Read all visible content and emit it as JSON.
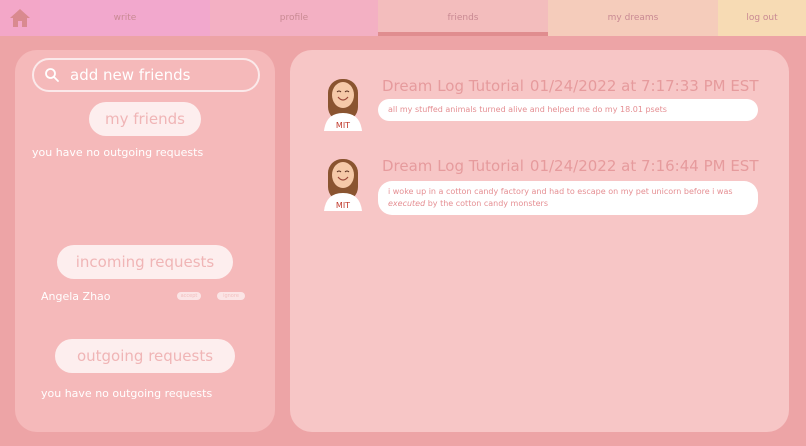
{
  "nav": {
    "home_icon": "home-icon",
    "tabs": [
      {
        "label": "write"
      },
      {
        "label": "profile"
      },
      {
        "label": "friends"
      },
      {
        "label": "my dreams"
      },
      {
        "label": "log out"
      }
    ],
    "active_tab": "friends",
    "colors": {
      "write": "#f2a8cd",
      "profile": "#f3b0c3",
      "friends": "#f3bdbd",
      "my_dreams": "#f5ccbb",
      "log_out": "#f7dbb4"
    }
  },
  "friends_panel": {
    "search": {
      "placeholder": "add new friends",
      "icon": "search-icon"
    },
    "my_friends_label": "my friends",
    "my_friends_text": "you have no outgoing requests",
    "incoming_label": "incoming requests",
    "incoming_requests": [
      {
        "name": "Angela Zhao",
        "accept_label": "accept",
        "reject_label": "ignore"
      }
    ],
    "outgoing_label": "outgoing requests",
    "outgoing_text": "you have no outgoing requests"
  },
  "feed": {
    "entries": [
      {
        "author": "Dream Log Tutorial",
        "timestamp": "01/24/2022 at 7:17:33 PM EST",
        "text": "all my stuffed animals turned alive and helped me do my 18.01 psets"
      },
      {
        "author": "Dream Log Tutorial",
        "timestamp": "01/24/2022 at 7:16:44 PM EST",
        "text_before": "i woke up in a cotton candy factory and had to escape on my pet unicorn before i was ",
        "text_emphasis": "executed",
        "text_after": " by the cotton candy monsters"
      }
    ],
    "avatar_label": "MIT"
  },
  "colors": {
    "background": "#eda4a6",
    "left_panel": "#f5b9ba",
    "right_panel": "#f7c6c6",
    "accent_text": "#e69b9d"
  }
}
